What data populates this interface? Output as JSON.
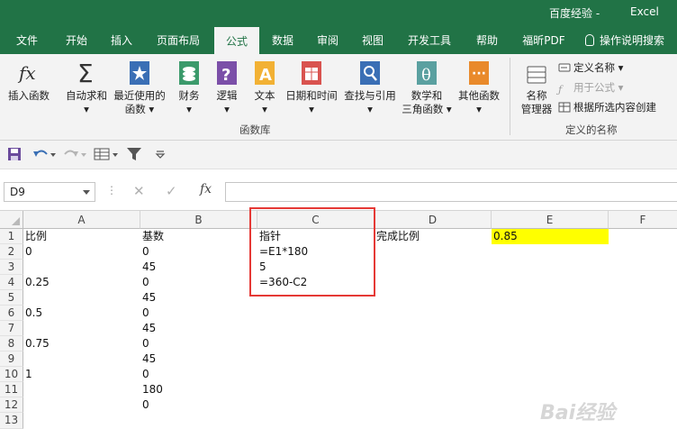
{
  "window": {
    "document": "百度经验",
    "separator": " - ",
    "app": "Excel"
  },
  "tabs": [
    {
      "label": "文件"
    },
    {
      "label": "开始"
    },
    {
      "label": "插入"
    },
    {
      "label": "页面布局"
    },
    {
      "label": "公式"
    },
    {
      "label": "数据"
    },
    {
      "label": "审阅"
    },
    {
      "label": "视图"
    },
    {
      "label": "开发工具"
    },
    {
      "label": "帮助"
    },
    {
      "label": "福昕PDF"
    },
    {
      "label": "操作说明搜索"
    }
  ],
  "active_tab": "公式",
  "ribbon": {
    "insert_function": "插入函数",
    "autosum": "自动求和",
    "recent_1": "最近使用的",
    "recent_2": "函数",
    "financial": "财务",
    "logical": "逻辑",
    "text": "文本",
    "datetime": "日期和时间",
    "lookup": "查找与引用",
    "math_1": "数学和",
    "math_2": "三角函数",
    "more": "其他函数",
    "group_library": "函数库",
    "name_manager_1": "名称",
    "name_manager_2": "管理器",
    "define_name": "定义名称",
    "use_in_formula": "用于公式",
    "create_from_selection": "根据所选内容创建",
    "group_names": "定义的名称"
  },
  "formula_bar": {
    "name_box": "D9",
    "formula": ""
  },
  "columns": [
    "A",
    "B",
    "C",
    "D",
    "E",
    "F"
  ],
  "rows": [
    "1",
    "2",
    "3",
    "4",
    "5",
    "6",
    "7",
    "8",
    "9",
    "10",
    "11",
    "12",
    "13"
  ],
  "cells": {
    "A1": "比例",
    "B1": "基数",
    "C1": "指针",
    "D1": "完成比例",
    "E1": "0.85",
    "A2": "0",
    "B2": "0",
    "C2": "=E1*180",
    "B3": "45",
    "C3": "5",
    "A4": "0.25",
    "B4": "0",
    "C4": "=360-C2",
    "B5": "45",
    "A6": "0.5",
    "B6": "0",
    "B7": "45",
    "A8": "0.75",
    "B8": "0",
    "B9": "45",
    "A10": "1",
    "B10": "0",
    "B11": "180",
    "B12": "0"
  },
  "colors": {
    "excel_green": "#217346",
    "highlight_yellow": "#ffff00",
    "annotation_red": "#e53935"
  },
  "watermark": "Bai经验"
}
